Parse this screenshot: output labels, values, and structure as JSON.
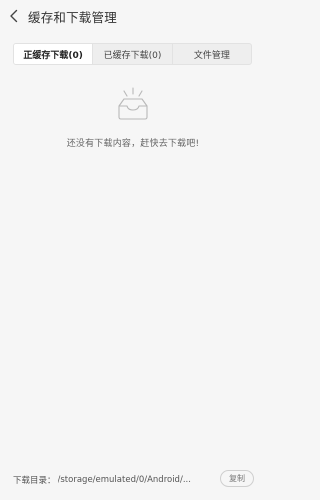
{
  "header": {
    "title": "缓存和下载管理",
    "back_icon": "chevron-left-icon"
  },
  "tabs": [
    {
      "label": "正缓存下载(0)",
      "active": true
    },
    {
      "label": "已缓存下载(0)",
      "active": false
    },
    {
      "label": "文件管理",
      "active": false
    }
  ],
  "empty_state": {
    "icon": "empty-inbox-icon",
    "message": "还没有下载内容，赶快去下载吧!"
  },
  "footer": {
    "label": "下载目录：",
    "path": "/storage/emulated/0/Android/...",
    "copy_label": "复制"
  },
  "colors": {
    "background": "#f6f6f6",
    "tab_active_bg": "#ffffff",
    "tab_bg": "#eeeeee",
    "text": "#333333",
    "muted_text": "#666666"
  }
}
